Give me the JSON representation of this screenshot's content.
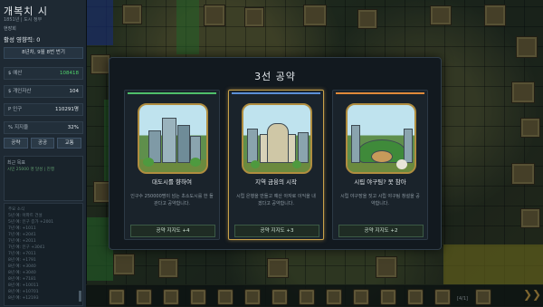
{
  "sidebar": {
    "city_name": "개복치 시",
    "city_subtitle": "1851년 | 도시 정부",
    "turn_label": "현장회",
    "approval": "활성 영향력: 0",
    "date": "8년차, 9월 8번 번기",
    "stats": [
      {
        "icon": "dollar-icon",
        "label": "$ 예산",
        "value": "108418",
        "color": "#4fd16a"
      },
      {
        "icon": "dollar-icon",
        "label": "$ 개인자산",
        "value": "104",
        "color": "#e2e8ed"
      },
      {
        "icon": "people-icon",
        "label": "P 인구",
        "value": "110291명",
        "color": "#e2e8ed"
      },
      {
        "icon": "percent-icon",
        "label": "% 지지율",
        "value": "32%",
        "color": "#e2e8ed"
      }
    ],
    "buttons": [
      "공략",
      "공공",
      "교통"
    ],
    "info_title": "최근 목표",
    "info_line": "시민 25000 명 달성 | 진행",
    "log_lines": [
      "주요 소식",
      "5년 예: 아파트 건설",
      "5년 예: 인구 증가 +2001",
      "7년 예: +1011",
      "7년 예: +2041",
      "7년 예: +2011",
      "7년 예: 인구 +3041",
      "7년 예: +7011",
      "8년 예: +1791",
      "8년 예: +3040",
      "8년 예: +3040",
      "8년 예: +7181",
      "8년 예: +10011",
      "8년 예: +10701",
      "8년 예: +12193"
    ]
  },
  "modal": {
    "title": "3선 공약",
    "cards": [
      {
        "title": "대도시를 향하여",
        "description": "인구수 250000명이 넘는 초소도시를 한 들관다고 공약합니다.",
        "button": "공약 지지도 +4",
        "accent": "#4fbf6a",
        "icon": "skyscraper-city-icon",
        "selected": false
      },
      {
        "title": "지역 금융의 시작",
        "description": "시립 은행을 만들고 예산 아자로 이익을 내겠다고 공약합니다.",
        "button": "공약 지지도 +3",
        "accent": "#5b8fd6",
        "icon": "bank-building-icon",
        "selected": true
      },
      {
        "title": "시립 야구팀? 못 참아",
        "description": "시립 야구장을 짓고 시립 야구팀 창설을 공약합니다.",
        "button": "공약 지지도 +2",
        "accent": "#e08a3a",
        "icon": "baseball-stadium-icon",
        "selected": false
      }
    ]
  },
  "toolbar": {
    "label": "[4/1]",
    "fast_forward_icon": "fast-forward-icon"
  }
}
